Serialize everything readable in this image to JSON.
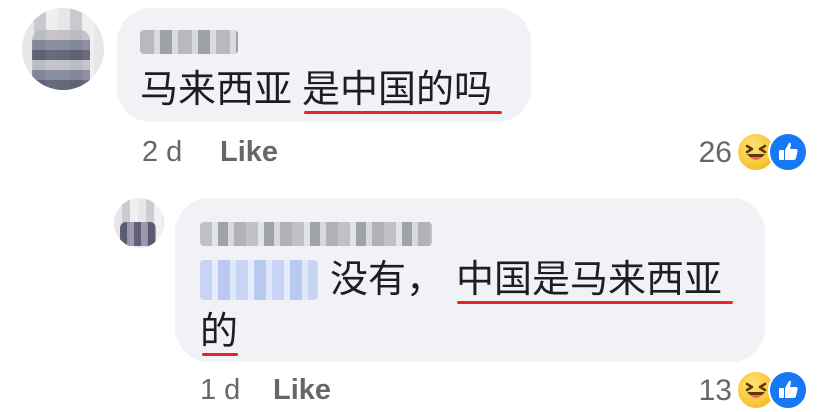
{
  "comments": [
    {
      "text_main": "马来西亚",
      "text_underlined": "是中国的吗",
      "age": "2 d",
      "like_label": "Like",
      "reaction_count": "26",
      "reactions": [
        "haha-reaction-icon",
        "like-reaction-icon"
      ]
    },
    {
      "text_main": "没有，",
      "text_underlined_1": "中国是马来西亚",
      "text_underlined_2": "的",
      "age": "1 d",
      "like_label": "Like",
      "reaction_count": "13",
      "reactions": [
        "haha-reaction-icon",
        "like-reaction-icon"
      ]
    }
  ],
  "colors": {
    "bubble": "#f0f2f5",
    "underline": "#e4252b",
    "meta_text": "#65676b",
    "like_reaction": "#1877f2",
    "haha_reaction": "#f7c531"
  }
}
